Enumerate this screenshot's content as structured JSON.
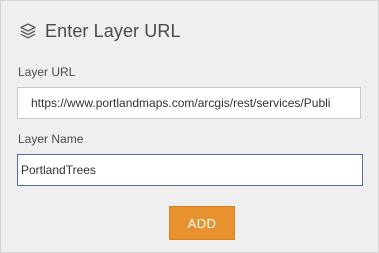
{
  "header": {
    "icon": "layers-icon",
    "title": "Enter Layer URL"
  },
  "form": {
    "url_label": "Layer URL",
    "url_value": "https://www.portlandmaps.com/arcgis/rest/services/Publi",
    "name_label": "Layer Name",
    "name_value": "PortlandTrees"
  },
  "actions": {
    "add_label": "ADD"
  },
  "colors": {
    "panel_bg": "#efefef",
    "accent": "#e8912f",
    "focus_border": "#566fa0"
  }
}
